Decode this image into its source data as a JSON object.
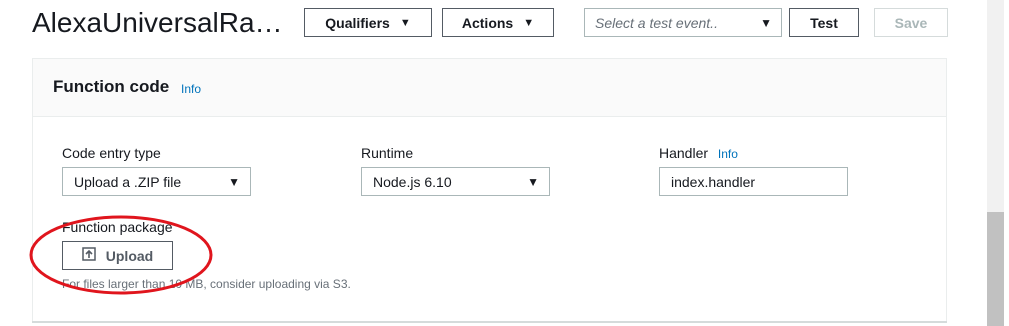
{
  "header": {
    "function_name": "AlexaUniversalRas…",
    "qualifiers_label": "Qualifiers",
    "actions_label": "Actions",
    "test_event_placeholder": "Select a test event..",
    "test_label": "Test",
    "save_label": "Save"
  },
  "function_code": {
    "title": "Function code",
    "info": "Info",
    "code_entry": {
      "label": "Code entry type",
      "value": "Upload a .ZIP file"
    },
    "runtime": {
      "label": "Runtime",
      "value": "Node.js 6.10"
    },
    "handler": {
      "label": "Handler",
      "info": "Info",
      "value": "index.handler"
    },
    "package": {
      "label": "Function package",
      "upload_label": "Upload",
      "hint": "For files larger than 10 MB, consider uploading via S3."
    }
  },
  "colors": {
    "link": "#0073bb",
    "annotation": "#e0151d"
  },
  "icons": {
    "dropdown": "caret-down-icon",
    "upload": "upload-icon"
  }
}
